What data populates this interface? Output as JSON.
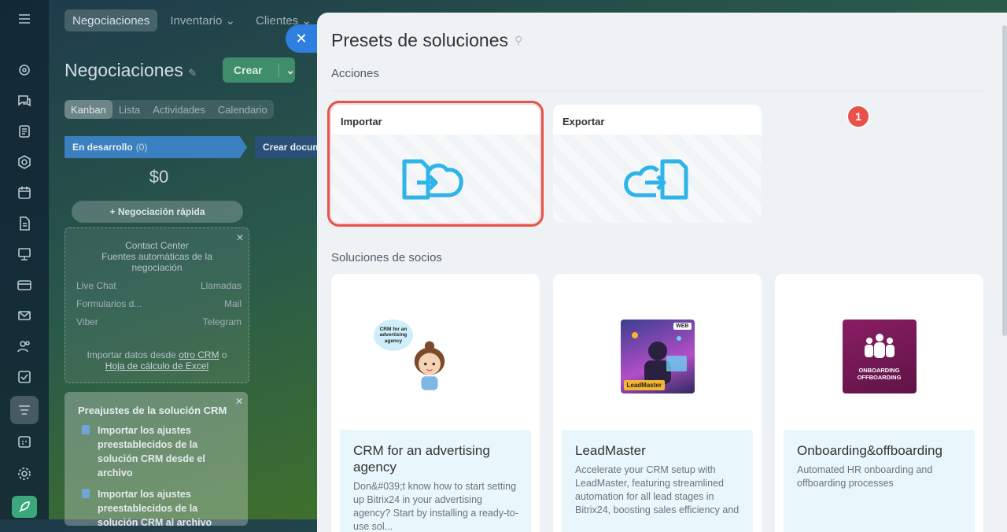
{
  "background_page": {
    "nav": [
      "Negociaciones",
      "Inventario",
      "Clientes"
    ],
    "title": "Negociaciones",
    "create_button": "Crear",
    "view_tabs": [
      "Kanban",
      "Lista",
      "Actividades",
      "Calendario"
    ],
    "stages": [
      {
        "name": "En desarrollo",
        "count": "(0)"
      },
      {
        "name": "Crear docum"
      }
    ],
    "stage_amount": "$0",
    "quick_deal": "Negociación rápida",
    "contact_center": {
      "title": "Contact Center",
      "subtitle": "Fuentes automáticas de la negociación",
      "sources": [
        "Live Chat",
        "Llamadas",
        "Formularios d...",
        "Mail",
        "Viber",
        "Telegram"
      ],
      "import_prefix": "Importar datos desde",
      "import_link_1": "otro CRM",
      "import_or": "o",
      "import_link_2": "Hoja de cálculo de Excel"
    },
    "presets_box": {
      "title": "Preajustes de la solución CRM",
      "items": [
        "Importar los ajustes preestablecidos de la solución CRM desde el archivo",
        "Importar los ajustes preestablecidos de la solución CRM al archivo"
      ]
    }
  },
  "panel": {
    "title": "Presets de soluciones",
    "actions_section": "Acciones",
    "actions": [
      {
        "label": "Importar",
        "icon": "import-cloud-icon",
        "highlighted": true,
        "badge": "1"
      },
      {
        "label": "Exportar",
        "icon": "export-cloud-icon"
      }
    ],
    "partners_section": "Soluciones de socios",
    "partners": [
      {
        "name": "CRM for an advertising agency",
        "logo_text": "CRM for an advertising agency",
        "description": "Don&#039;t know how to start setting up Bitrix24 in your advertising agency? Start by installing a ready-to-use sol..."
      },
      {
        "name": "LeadMaster",
        "logo_text": "LeadMaster",
        "logo_badge": "WEB",
        "description": "Accelerate your CRM setup with LeadMaster, featuring streamlined automation for all lead stages in Bitrix24, boosting sales efficiency and"
      },
      {
        "name": "Onboarding&offboarding",
        "logo_text": "ONBOARDING OFFBOARDING",
        "description": "Automated HR onboarding and offboarding processes"
      }
    ]
  },
  "colors": {
    "accent_red": "#e8524a",
    "blue": "#2f7fe0",
    "import_icon": "#2fb4e9"
  }
}
